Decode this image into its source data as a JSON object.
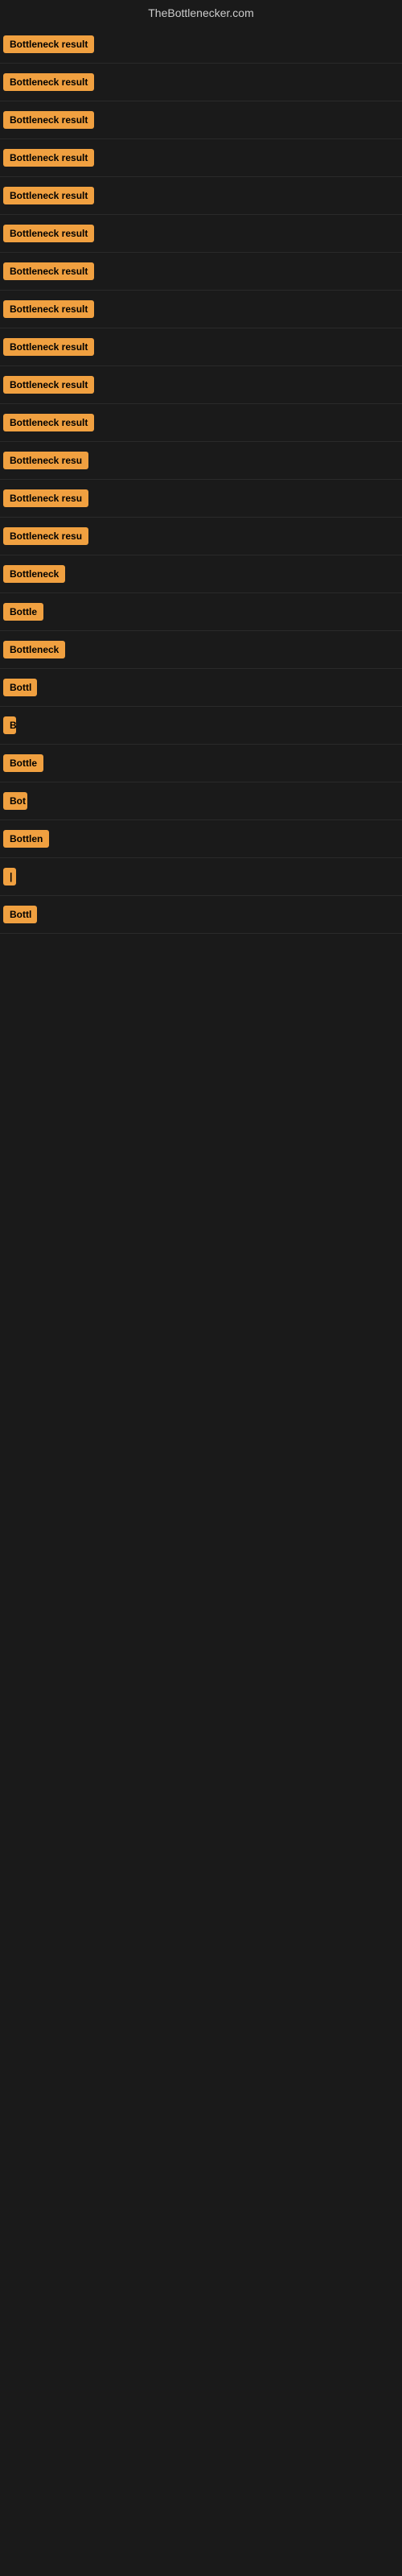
{
  "site": {
    "title": "TheBottlenecker.com"
  },
  "results": [
    {
      "id": 1,
      "label": "Bottleneck result",
      "width": 120
    },
    {
      "id": 2,
      "label": "Bottleneck result",
      "width": 120
    },
    {
      "id": 3,
      "label": "Bottleneck result",
      "width": 120
    },
    {
      "id": 4,
      "label": "Bottleneck result",
      "width": 120
    },
    {
      "id": 5,
      "label": "Bottleneck result",
      "width": 120
    },
    {
      "id": 6,
      "label": "Bottleneck result",
      "width": 120
    },
    {
      "id": 7,
      "label": "Bottleneck result",
      "width": 120
    },
    {
      "id": 8,
      "label": "Bottleneck result",
      "width": 120
    },
    {
      "id": 9,
      "label": "Bottleneck result",
      "width": 120
    },
    {
      "id": 10,
      "label": "Bottleneck result",
      "width": 120
    },
    {
      "id": 11,
      "label": "Bottleneck result",
      "width": 120
    },
    {
      "id": 12,
      "label": "Bottleneck resu",
      "width": 110
    },
    {
      "id": 13,
      "label": "Bottleneck resu",
      "width": 110
    },
    {
      "id": 14,
      "label": "Bottleneck resu",
      "width": 110
    },
    {
      "id": 15,
      "label": "Bottleneck",
      "width": 80
    },
    {
      "id": 16,
      "label": "Bottle",
      "width": 50
    },
    {
      "id": 17,
      "label": "Bottleneck",
      "width": 80
    },
    {
      "id": 18,
      "label": "Bottl",
      "width": 42
    },
    {
      "id": 19,
      "label": "B",
      "width": 14
    },
    {
      "id": 20,
      "label": "Bottle",
      "width": 50
    },
    {
      "id": 21,
      "label": "Bot",
      "width": 30
    },
    {
      "id": 22,
      "label": "Bottlen",
      "width": 58
    },
    {
      "id": 23,
      "label": "|",
      "width": 10
    },
    {
      "id": 24,
      "label": "Bottl",
      "width": 42
    }
  ]
}
